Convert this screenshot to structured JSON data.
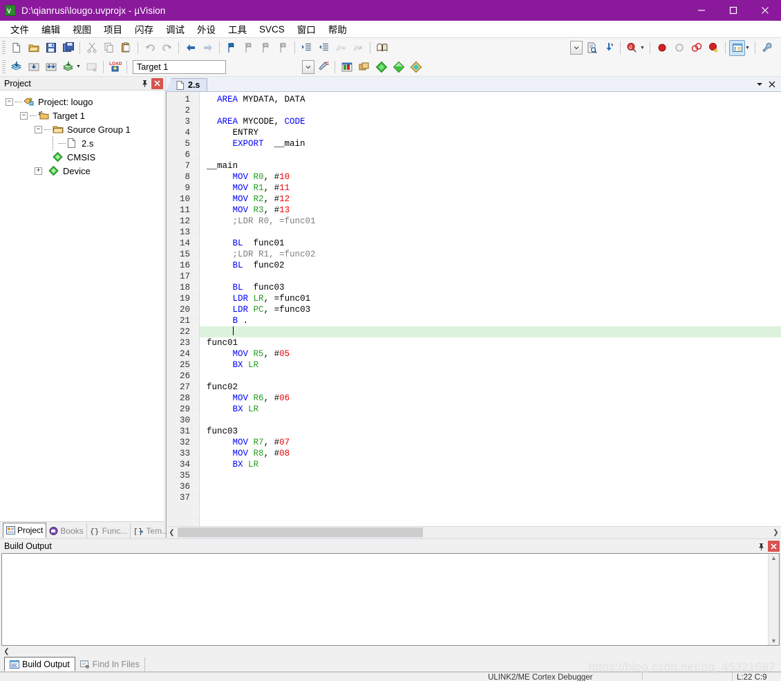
{
  "titlebar": {
    "title": "D:\\qianrusi\\lougo.uvprojx - µVision",
    "app_icon": "uvision-icon",
    "minimize": "—",
    "maximize": "☐",
    "close": "✕"
  },
  "menubar": {
    "items": [
      {
        "label": "文件",
        "name": "menu-file"
      },
      {
        "label": "编辑",
        "name": "menu-edit"
      },
      {
        "label": "视图",
        "name": "menu-view"
      },
      {
        "label": "项目",
        "name": "menu-project"
      },
      {
        "label": "闪存",
        "name": "menu-flash"
      },
      {
        "label": "调试",
        "name": "menu-debug"
      },
      {
        "label": "外设",
        "name": "menu-peripherals"
      },
      {
        "label": "工具",
        "name": "menu-tools"
      },
      {
        "label": "SVCS",
        "name": "menu-svcs"
      },
      {
        "label": "窗口",
        "name": "menu-window"
      },
      {
        "label": "帮助",
        "name": "menu-help"
      }
    ]
  },
  "toolbar2": {
    "target_value": "Target 1",
    "target_placeholder": "Target 1"
  },
  "project_panel": {
    "header": "Project",
    "pin_icon": "pin-icon",
    "close_icon": "close-icon",
    "tree": [
      {
        "label": "Project: lougo",
        "icon": "project-icon",
        "depth": 0,
        "expander": "-"
      },
      {
        "label": "Target 1",
        "icon": "target-icon",
        "depth": 1,
        "expander": "-"
      },
      {
        "label": "Source Group 1",
        "icon": "folder-icon",
        "depth": 2,
        "expander": "-"
      },
      {
        "label": "2.s",
        "icon": "file-icon",
        "depth": 3,
        "expander": ""
      },
      {
        "label": "CMSIS",
        "icon": "component-icon",
        "depth": 2,
        "expander": ""
      },
      {
        "label": "Device",
        "icon": "component-icon",
        "depth": 2,
        "expander": "+"
      }
    ],
    "tabs": [
      {
        "label": "Project",
        "icon": "project-tab-icon",
        "active": true
      },
      {
        "label": "Books",
        "icon": "books-icon",
        "active": false
      },
      {
        "label": "Func...",
        "icon": "functions-icon",
        "active": false
      },
      {
        "label": "Tem...",
        "icon": "templates-icon",
        "active": false
      }
    ]
  },
  "editor": {
    "tab_label": "2.s",
    "tab_icon": "file-icon",
    "dropdown_icon": "chevron-down-icon",
    "close_icon": "close-icon",
    "cursor_line": 22,
    "highlight_line": 22,
    "lines": [
      {
        "n": 1,
        "tokens": [
          {
            "t": "  ",
            "c": "plain"
          },
          {
            "t": "AREA",
            "c": "kw"
          },
          {
            "t": " MYDATA, DATA",
            "c": "plain"
          }
        ]
      },
      {
        "n": 2,
        "tokens": []
      },
      {
        "n": 3,
        "tokens": [
          {
            "t": "  ",
            "c": "plain"
          },
          {
            "t": "AREA",
            "c": "kw"
          },
          {
            "t": " MYCODE, ",
            "c": "plain"
          },
          {
            "t": "CODE",
            "c": "kw"
          }
        ]
      },
      {
        "n": 4,
        "tokens": [
          {
            "t": "     ",
            "c": "plain"
          },
          {
            "t": "ENTRY",
            "c": "plain"
          }
        ]
      },
      {
        "n": 5,
        "tokens": [
          {
            "t": "     ",
            "c": "plain"
          },
          {
            "t": "EXPORT",
            "c": "kw"
          },
          {
            "t": "  __main",
            "c": "plain"
          }
        ]
      },
      {
        "n": 6,
        "tokens": []
      },
      {
        "n": 7,
        "tokens": [
          {
            "t": "__main",
            "c": "plain"
          }
        ]
      },
      {
        "n": 8,
        "tokens": [
          {
            "t": "     ",
            "c": "plain"
          },
          {
            "t": "MOV",
            "c": "kw"
          },
          {
            "t": " ",
            "c": "plain"
          },
          {
            "t": "R0",
            "c": "reg"
          },
          {
            "t": ", #",
            "c": "plain"
          },
          {
            "t": "10",
            "c": "num"
          }
        ]
      },
      {
        "n": 9,
        "tokens": [
          {
            "t": "     ",
            "c": "plain"
          },
          {
            "t": "MOV",
            "c": "kw"
          },
          {
            "t": " ",
            "c": "plain"
          },
          {
            "t": "R1",
            "c": "reg"
          },
          {
            "t": ", #",
            "c": "plain"
          },
          {
            "t": "11",
            "c": "num"
          }
        ]
      },
      {
        "n": 10,
        "tokens": [
          {
            "t": "     ",
            "c": "plain"
          },
          {
            "t": "MOV",
            "c": "kw"
          },
          {
            "t": " ",
            "c": "plain"
          },
          {
            "t": "R2",
            "c": "reg"
          },
          {
            "t": ", #",
            "c": "plain"
          },
          {
            "t": "12",
            "c": "num"
          }
        ]
      },
      {
        "n": 11,
        "tokens": [
          {
            "t": "     ",
            "c": "plain"
          },
          {
            "t": "MOV",
            "c": "kw"
          },
          {
            "t": " ",
            "c": "plain"
          },
          {
            "t": "R3",
            "c": "reg"
          },
          {
            "t": ", #",
            "c": "plain"
          },
          {
            "t": "13",
            "c": "num"
          }
        ]
      },
      {
        "n": 12,
        "tokens": [
          {
            "t": "     ;LDR R0, =func01",
            "c": "cmt"
          }
        ]
      },
      {
        "n": 13,
        "tokens": []
      },
      {
        "n": 14,
        "tokens": [
          {
            "t": "     ",
            "c": "plain"
          },
          {
            "t": "BL",
            "c": "kw"
          },
          {
            "t": "  func01",
            "c": "plain"
          }
        ]
      },
      {
        "n": 15,
        "tokens": [
          {
            "t": "     ;LDR R1, =func02",
            "c": "cmt"
          }
        ]
      },
      {
        "n": 16,
        "tokens": [
          {
            "t": "     ",
            "c": "plain"
          },
          {
            "t": "BL",
            "c": "kw"
          },
          {
            "t": "  func02",
            "c": "plain"
          }
        ]
      },
      {
        "n": 17,
        "tokens": []
      },
      {
        "n": 18,
        "tokens": [
          {
            "t": "     ",
            "c": "plain"
          },
          {
            "t": "BL",
            "c": "kw"
          },
          {
            "t": "  func03",
            "c": "plain"
          }
        ]
      },
      {
        "n": 19,
        "tokens": [
          {
            "t": "     ",
            "c": "plain"
          },
          {
            "t": "LDR",
            "c": "kw"
          },
          {
            "t": " ",
            "c": "plain"
          },
          {
            "t": "LR",
            "c": "reg"
          },
          {
            "t": ", =func01",
            "c": "plain"
          }
        ]
      },
      {
        "n": 20,
        "tokens": [
          {
            "t": "     ",
            "c": "plain"
          },
          {
            "t": "LDR",
            "c": "kw"
          },
          {
            "t": " ",
            "c": "plain"
          },
          {
            "t": "PC",
            "c": "reg"
          },
          {
            "t": ", =func03",
            "c": "plain"
          }
        ]
      },
      {
        "n": 21,
        "tokens": [
          {
            "t": "     ",
            "c": "plain"
          },
          {
            "t": "B",
            "c": "kw"
          },
          {
            "t": " .",
            "c": "plain"
          }
        ]
      },
      {
        "n": 22,
        "tokens": [
          {
            "t": "     ",
            "c": "plain"
          }
        ]
      },
      {
        "n": 23,
        "tokens": [
          {
            "t": "func01",
            "c": "plain"
          }
        ]
      },
      {
        "n": 24,
        "tokens": [
          {
            "t": "     ",
            "c": "plain"
          },
          {
            "t": "MOV",
            "c": "kw"
          },
          {
            "t": " ",
            "c": "plain"
          },
          {
            "t": "R5",
            "c": "reg"
          },
          {
            "t": ", #",
            "c": "plain"
          },
          {
            "t": "05",
            "c": "num"
          }
        ]
      },
      {
        "n": 25,
        "tokens": [
          {
            "t": "     ",
            "c": "plain"
          },
          {
            "t": "BX",
            "c": "kw"
          },
          {
            "t": " ",
            "c": "plain"
          },
          {
            "t": "LR",
            "c": "reg"
          }
        ]
      },
      {
        "n": 26,
        "tokens": []
      },
      {
        "n": 27,
        "tokens": [
          {
            "t": "func02",
            "c": "plain"
          }
        ]
      },
      {
        "n": 28,
        "tokens": [
          {
            "t": "     ",
            "c": "plain"
          },
          {
            "t": "MOV",
            "c": "kw"
          },
          {
            "t": " ",
            "c": "plain"
          },
          {
            "t": "R6",
            "c": "reg"
          },
          {
            "t": ", #",
            "c": "plain"
          },
          {
            "t": "06",
            "c": "num"
          }
        ]
      },
      {
        "n": 29,
        "tokens": [
          {
            "t": "     ",
            "c": "plain"
          },
          {
            "t": "BX",
            "c": "kw"
          },
          {
            "t": " ",
            "c": "plain"
          },
          {
            "t": "LR",
            "c": "reg"
          }
        ]
      },
      {
        "n": 30,
        "tokens": []
      },
      {
        "n": 31,
        "tokens": [
          {
            "t": "func03",
            "c": "plain"
          }
        ]
      },
      {
        "n": 32,
        "tokens": [
          {
            "t": "     ",
            "c": "plain"
          },
          {
            "t": "MOV",
            "c": "kw"
          },
          {
            "t": " ",
            "c": "plain"
          },
          {
            "t": "R7",
            "c": "reg"
          },
          {
            "t": ", #",
            "c": "plain"
          },
          {
            "t": "07",
            "c": "num"
          }
        ]
      },
      {
        "n": 33,
        "tokens": [
          {
            "t": "     ",
            "c": "plain"
          },
          {
            "t": "MOV",
            "c": "kw"
          },
          {
            "t": " ",
            "c": "plain"
          },
          {
            "t": "R8",
            "c": "reg"
          },
          {
            "t": ", #",
            "c": "plain"
          },
          {
            "t": "08",
            "c": "num"
          }
        ]
      },
      {
        "n": 34,
        "tokens": [
          {
            "t": "     ",
            "c": "plain"
          },
          {
            "t": "BX",
            "c": "kw"
          },
          {
            "t": " ",
            "c": "plain"
          },
          {
            "t": "LR",
            "c": "reg"
          }
        ]
      },
      {
        "n": 35,
        "tokens": []
      },
      {
        "n": 36,
        "tokens": []
      },
      {
        "n": 37,
        "tokens": []
      }
    ]
  },
  "build_panel": {
    "header": "Build Output",
    "pin_icon": "pin-icon",
    "close_icon": "close-icon",
    "content": ""
  },
  "bottom_tabs": [
    {
      "label": "Build Output",
      "icon": "build-output-icon",
      "active": true
    },
    {
      "label": "Find In Files",
      "icon": "find-in-files-icon",
      "active": false
    }
  ],
  "statusbar": {
    "debugger": "ULINK2/ME Cortex Debugger",
    "blank": "",
    "position": "L:22 C:9"
  },
  "watermark": "https://blog.csdn.net/qq_45321687",
  "colors": {
    "titlebar": "#8a1a9b",
    "keyword": "#0000ff",
    "register": "#1f9c1f",
    "number": "#ee0000",
    "comment": "#7e7e7e",
    "current_line": "#ddf2dd",
    "close_button": "#d9534f"
  }
}
